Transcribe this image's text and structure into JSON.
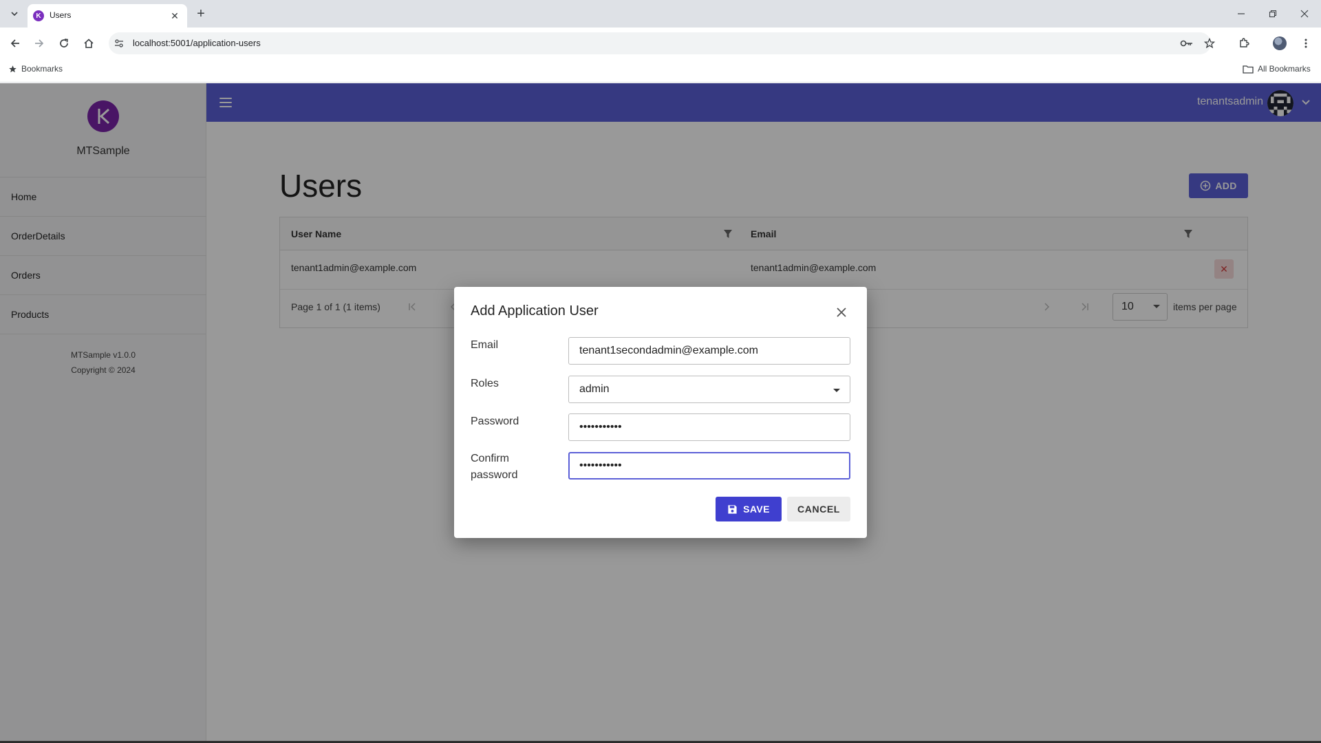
{
  "browser": {
    "tab_title": "Users",
    "url": "localhost:5001/application-users",
    "bookmarks_label": "Bookmarks",
    "all_bookmarks_label": "All Bookmarks"
  },
  "app": {
    "brand_name": "MTSample",
    "version": "MTSample v1.0.0",
    "copyright": "Copyright © 2024",
    "nav_items": [
      {
        "label": "Home"
      },
      {
        "label": "OrderDetails"
      },
      {
        "label": "Orders"
      },
      {
        "label": "Products"
      }
    ],
    "user_name": "tenantsadmin",
    "accent_color": "#5b5fd7"
  },
  "page": {
    "title": "Users",
    "add_label": "ADD",
    "columns": [
      "User Name",
      "Email"
    ],
    "rows": [
      {
        "user_name": "tenant1admin@example.com",
        "email": "tenant1admin@example.com"
      }
    ],
    "pager_info": "Page 1 of 1 (1 items)",
    "page_size": "10",
    "per_page_label": "items per page"
  },
  "dialog": {
    "title": "Add Application User",
    "email_label": "Email",
    "email_value": "tenant1secondadmin@example.com",
    "roles_label": "Roles",
    "roles_value": "admin",
    "password_label": "Password",
    "password_value": "•••••••••••",
    "confirm_label_line1": "Confirm",
    "confirm_label_line2": "password",
    "confirm_value": "•••••••••••",
    "save_label": "SAVE",
    "cancel_label": "CANCEL"
  }
}
